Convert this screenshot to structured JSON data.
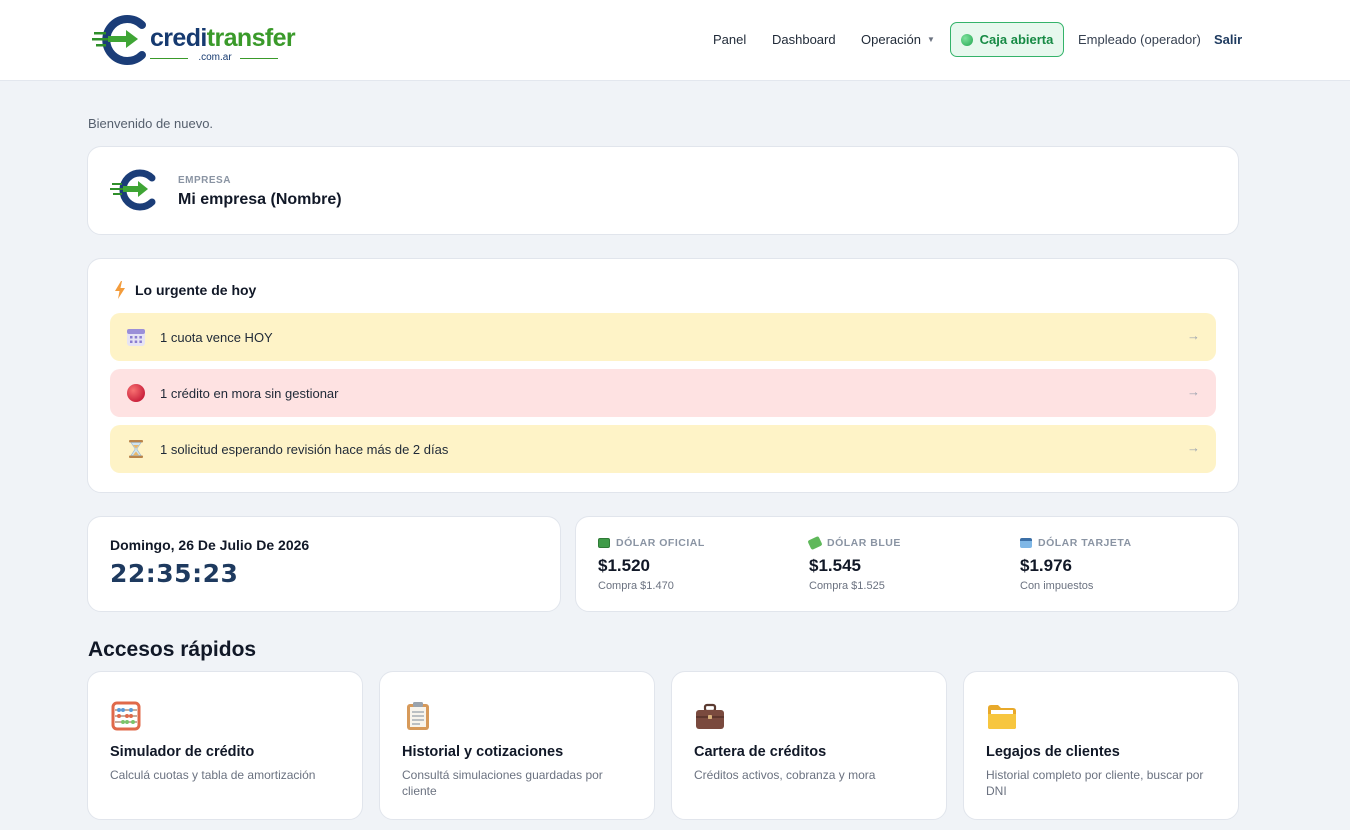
{
  "header": {
    "logo": {
      "word_part1": "credi",
      "word_part2": "transfer",
      "sub": ".com.ar"
    },
    "nav": {
      "panel": "Panel",
      "dashboard": "Dashboard",
      "operacion": "Operación",
      "caja": "Caja abierta",
      "empleado": "Empleado (operador)",
      "salir": "Salir"
    }
  },
  "welcome": "Bienvenido de nuevo.",
  "empresa": {
    "label": "EMPRESA",
    "name": "Mi empresa (Nombre)"
  },
  "urgent": {
    "title": "Lo urgente de hoy",
    "items": [
      {
        "text": "1 cuota vence HOY",
        "icon": "calendar-icon",
        "tone": "yellow"
      },
      {
        "text": "1 crédito en mora sin gestionar",
        "icon": "red-circle-icon",
        "tone": "red"
      },
      {
        "text": "1 solicitud esperando revisión hace más de 2 días",
        "icon": "hourglass-icon",
        "tone": "yellow"
      }
    ],
    "arrow": "→"
  },
  "datetime": {
    "date": "Domingo, 26 De Julio De 2026",
    "time": "22:35:23"
  },
  "dollars": [
    {
      "label": "DÓLAR OFICIAL",
      "value": "$1.520",
      "sub": "Compra $1.470",
      "icon": "banknote-icon"
    },
    {
      "label": "DÓLAR BLUE",
      "value": "$1.545",
      "sub": "Compra $1.525",
      "icon": "flying-money-icon"
    },
    {
      "label": "DÓLAR TARJETA",
      "value": "$1.976",
      "sub": "Con impuestos",
      "icon": "credit-card-icon"
    }
  ],
  "quick_access": {
    "title": "Accesos rápidos",
    "items": [
      {
        "title": "Simulador de crédito",
        "desc": "Calculá cuotas y tabla de amortización",
        "icon": "abacus-icon"
      },
      {
        "title": "Historial y cotizaciones",
        "desc": "Consultá simulaciones guardadas por cliente",
        "icon": "clipboard-icon"
      },
      {
        "title": "Cartera de créditos",
        "desc": "Créditos activos, cobranza y mora",
        "icon": "briefcase-icon"
      },
      {
        "title": "Legajos de clientes",
        "desc": "Historial completo por cliente, buscar por DNI",
        "icon": "folder-icon"
      }
    ]
  },
  "colors": {
    "navy": "#1e3a5f",
    "brand_green": "#3a9a2a",
    "alert_yellow": "#fef3c7",
    "alert_red": "#fee2e2",
    "caja_green": "#178a45"
  }
}
